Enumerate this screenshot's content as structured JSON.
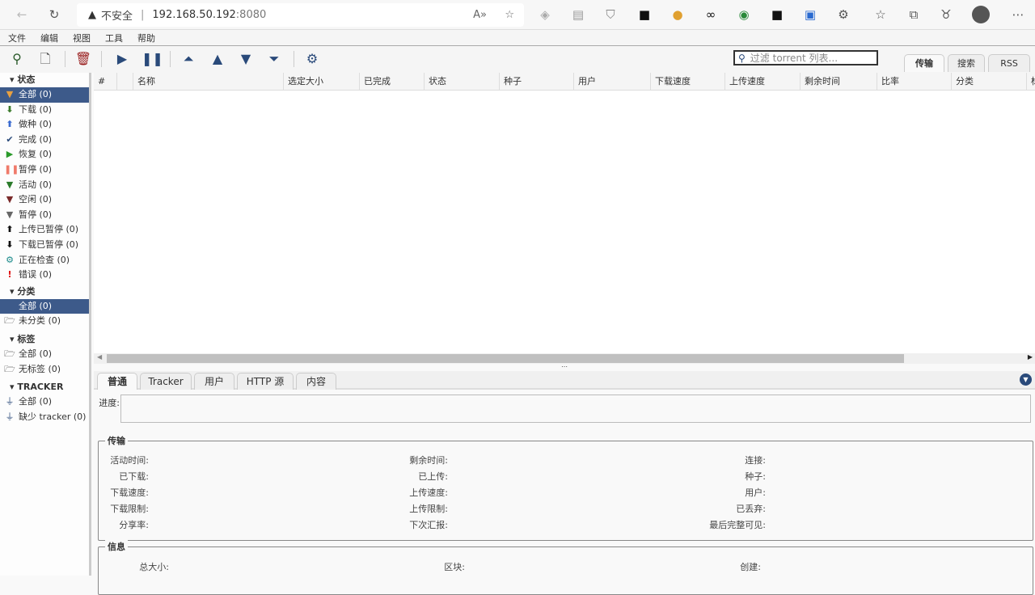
{
  "browser": {
    "security": "不安全",
    "url_host": "192.168.50.192",
    "url_port": ":8080"
  },
  "menu": [
    "文件",
    "编辑",
    "视图",
    "工具",
    "帮助"
  ],
  "filter": {
    "placeholder": "过滤 torrent 列表..."
  },
  "right_tabs": [
    "传输",
    "搜索",
    "RSS"
  ],
  "sidebar": {
    "status_header": "状态",
    "status": [
      {
        "label": "全部 (0)",
        "icon": "filter-icon",
        "color": "#e8a040",
        "selected": true
      },
      {
        "label": "下载 (0)",
        "icon": "arrow-down-icon",
        "color": "#3a7a2a"
      },
      {
        "label": "做种 (0)",
        "icon": "arrow-up-icon",
        "color": "#3a6ad0"
      },
      {
        "label": "完成 (0)",
        "icon": "check-icon",
        "color": "#2a4a7a"
      },
      {
        "label": "恢复 (0)",
        "icon": "play-icon",
        "color": "#2a9a2a"
      },
      {
        "label": "暂停 (0)",
        "icon": "pause-icon",
        "color": "#f07a6a"
      },
      {
        "label": "活动 (0)",
        "icon": "filter-icon",
        "color": "#2a7a2a"
      },
      {
        "label": "空闲 (0)",
        "icon": "filter-icon",
        "color": "#7a2a2a"
      },
      {
        "label": "暂停 (0)",
        "icon": "filter-icon",
        "color": "#666666"
      },
      {
        "label": "上传已暂停 (0)",
        "icon": "arrow-up-icon",
        "color": "#111111"
      },
      {
        "label": "下载已暂停 (0)",
        "icon": "arrow-down-icon",
        "color": "#111111"
      },
      {
        "label": "正在检查 (0)",
        "icon": "gear-icon",
        "color": "#1a8a8a"
      },
      {
        "label": "错误 (0)",
        "icon": "exclamation-icon",
        "color": "#e01010"
      }
    ],
    "category_header": "分类",
    "categories": [
      {
        "label": "全部 (0)",
        "selected": true
      },
      {
        "label": "未分类 (0)"
      }
    ],
    "tag_header": "标签",
    "tags": [
      {
        "label": "全部 (0)"
      },
      {
        "label": "无标签 (0)"
      }
    ],
    "tracker_header": "TRACKER",
    "trackers": [
      {
        "label": "全部 (0)"
      },
      {
        "label": "缺少 tracker (0)"
      }
    ]
  },
  "table": {
    "columns": [
      "#",
      "",
      "名称",
      "选定大小",
      "已完成",
      "状态",
      "种子",
      "用户",
      "下载速度",
      "上传速度",
      "剩余时间",
      "比率",
      "分类",
      "标"
    ]
  },
  "detail_tabs": [
    "普通",
    "Tracker",
    "用户",
    "HTTP 源",
    "内容"
  ],
  "progress_label": "进度:",
  "transfer": {
    "title": "传输",
    "col1": [
      "活动时间:",
      "已下载:",
      "下载速度:",
      "下载限制:",
      "分享率:"
    ],
    "col2": [
      "剩余时间:",
      "已上传:",
      "上传速度:",
      "上传限制:",
      "下次汇报:"
    ],
    "col3": [
      "连接:",
      "种子:",
      "用户:",
      "已丢弃:",
      "最后完整可见:"
    ]
  },
  "info": {
    "title": "信息",
    "labels": [
      "总大小:",
      "区块:",
      "创建:"
    ]
  }
}
